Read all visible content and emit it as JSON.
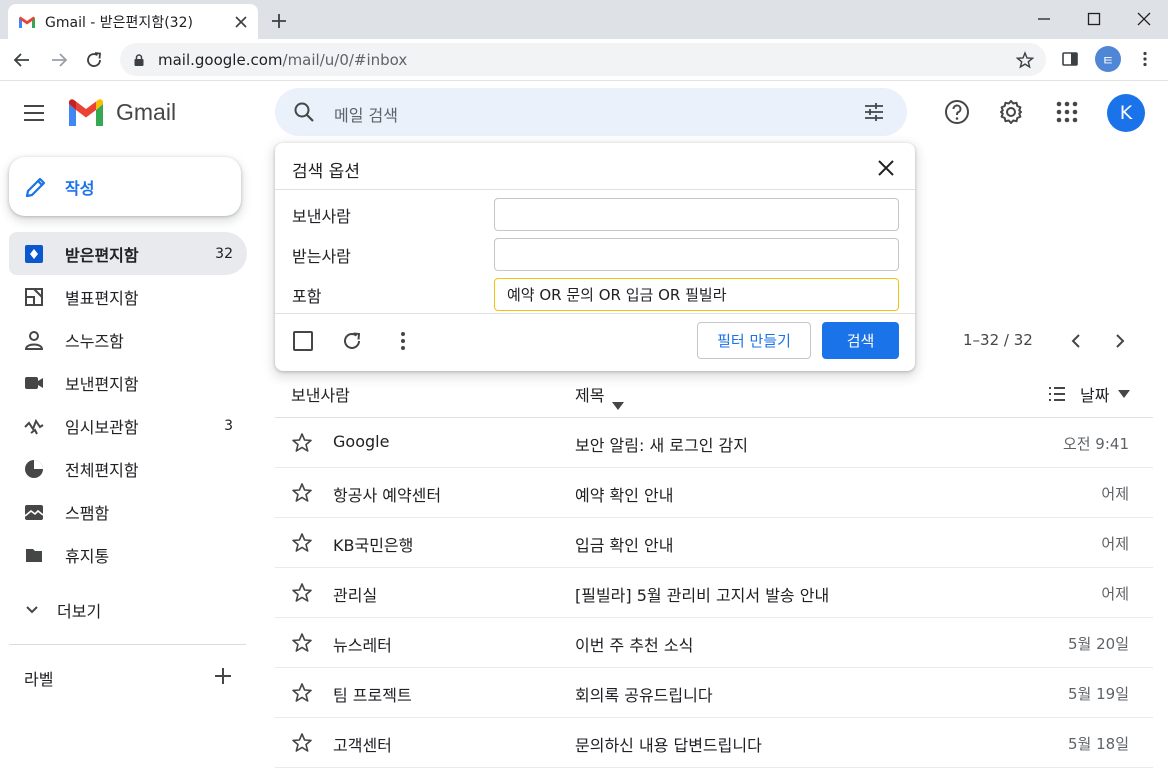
{
  "browser": {
    "tab_title": "Gmail - 받은편지함(32)",
    "url_host": "mail.google.com",
    "url_path": "/mail/u/0/#inbox",
    "profile_initial": "ㅌ"
  },
  "header": {
    "app_name": "Gmail",
    "search_placeholder": "메일 검색",
    "avatar_initial": "K"
  },
  "sidebar": {
    "compose_label": "작성",
    "items": [
      {
        "label": "받은편지함",
        "count": "32",
        "icon": "inbox-icon",
        "active": true
      },
      {
        "label": "별표편지함",
        "count": "",
        "icon": "starred-icon"
      },
      {
        "label": "스누즈함",
        "count": "",
        "icon": "snoozed-icon"
      },
      {
        "label": "보낸편지함",
        "count": "",
        "icon": "sent-icon"
      },
      {
        "label": "임시보관함",
        "count": "3",
        "icon": "drafts-icon"
      },
      {
        "label": "전체편지함",
        "count": "",
        "icon": "all-mail-icon"
      },
      {
        "label": "스팸함",
        "count": "",
        "icon": "spam-icon"
      },
      {
        "label": "휴지통",
        "count": "",
        "icon": "trash-icon"
      }
    ],
    "more_label": "더보기",
    "labels_title": "라벨"
  },
  "search_options": {
    "title": "검색 옵션",
    "from_label": "보낸사람",
    "from_value": "",
    "to_label": "받는사람",
    "to_value": "",
    "has_words_label": "포함",
    "has_words_value": "예약 OR 문의 OR 입금 OR 필빌라",
    "create_filter_label": "필터 만들기",
    "search_button_label": "검색"
  },
  "list": {
    "pagination": "1–32 / 32",
    "col_sender": "보낸사람",
    "col_subject": "제목",
    "col_date": "날짜",
    "rows": [
      {
        "sender": "Google",
        "subject": "보안 알림: 새 로그인 감지",
        "date": "오전 9:41"
      },
      {
        "sender": "항공사 예약센터",
        "subject": "예약 확인 안내",
        "date": "어제"
      },
      {
        "sender": "KB국민은행",
        "subject": "입금 확인 안내",
        "date": "어제"
      },
      {
        "sender": "관리실",
        "subject": "[필빌라] 5월 관리비 고지서 발송 안내",
        "date": "어제"
      },
      {
        "sender": "뉴스레터",
        "subject": "이번 주 추천 소식",
        "date": "5월 20일"
      },
      {
        "sender": "팀 프로젝트",
        "subject": "회의록 공유드립니다",
        "date": "5월 19일"
      },
      {
        "sender": "고객센터",
        "subject": "문의하신 내용 답변드립니다",
        "date": "5월 18일"
      }
    ]
  },
  "colors": {
    "accent": "#1a73e8",
    "search_bg": "#eaf1fb",
    "focus_border": "#f4c20d",
    "tabstrip": "#dee1e6"
  }
}
